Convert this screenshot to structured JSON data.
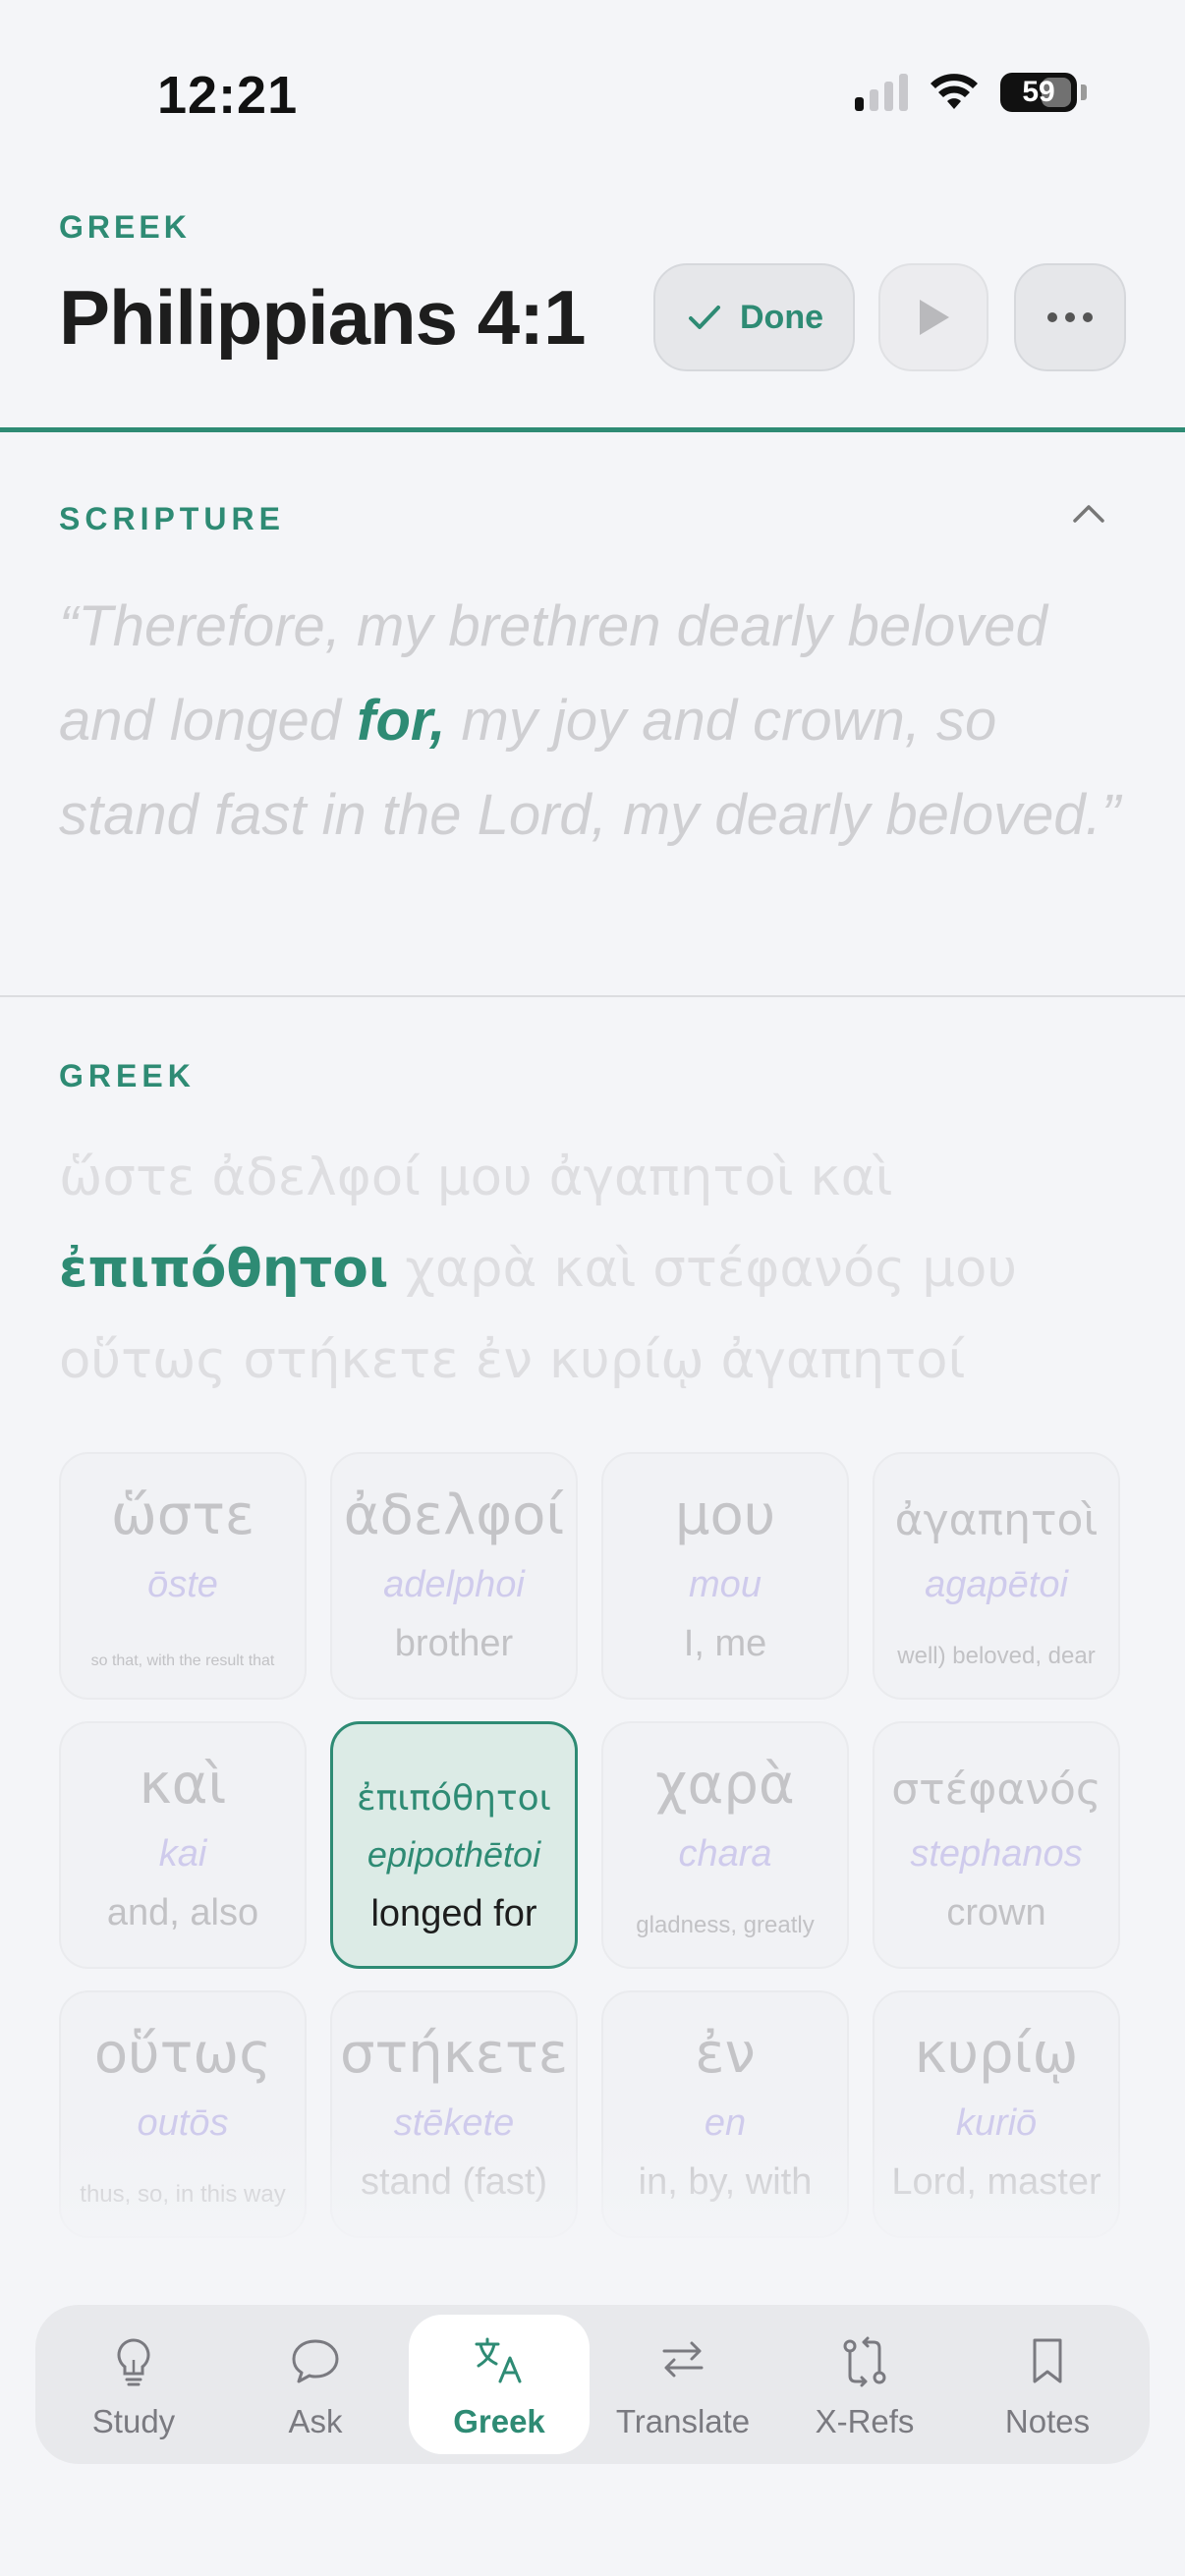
{
  "status": {
    "time": "12:21",
    "battery": "59"
  },
  "header": {
    "eyebrow": "GREEK",
    "title": "Philippians 4:1",
    "done_label": "Done",
    "icons": {
      "done": "check-icon",
      "play": "play-icon",
      "more": "more-icon"
    }
  },
  "scripture": {
    "label": "SCRIPTURE",
    "text_before": "“Therefore, my brethren dearly beloved and longed ",
    "highlight": "for,",
    "text_after": " my joy and crown, so stand fast in the Lord, my dearly beloved.”"
  },
  "greek": {
    "label": "GREEK",
    "text_before": "ὥστε ἀδελφοί μου ἀγαπητοὶ καὶ ",
    "highlight": "ἐπιπόθητοι",
    "text_after": " χαρὰ καὶ στέφανός μου οὕτως στήκετε ἐν κυρίῳ ἀγαπητοί"
  },
  "words": [
    {
      "greek": "ὥστε",
      "translit": "ōste",
      "english": "so that, with the result that",
      "size": "tiny"
    },
    {
      "greek": "ἀδελφοί",
      "translit": "adelphoi",
      "english": "brother",
      "size": "normal"
    },
    {
      "greek": "μου",
      "translit": "mou",
      "english": "I, me",
      "size": "normal"
    },
    {
      "greek": "ἀγαπητοὶ",
      "translit": "agapētoi",
      "english": "well) beloved, dear",
      "size": "small"
    },
    {
      "greek": "καὶ",
      "translit": "kai",
      "english": "and, also",
      "size": "normal"
    },
    {
      "greek": "ἐπιπόθητοι",
      "translit": "epipothētoi",
      "english": "longed for",
      "size": "normal",
      "selected": true
    },
    {
      "greek": "χαρὰ",
      "translit": "chara",
      "english": "gladness, greatly",
      "size": "small"
    },
    {
      "greek": "στέφανός",
      "translit": "stephanos",
      "english": "crown",
      "size": "normal"
    },
    {
      "greek": "οὕτως",
      "translit": "outōs",
      "english": "thus, so, in this way",
      "size": "small"
    },
    {
      "greek": "στήκετε",
      "translit": "stēkete",
      "english": "stand (fast)",
      "size": "normal"
    },
    {
      "greek": "ἐν",
      "translit": "en",
      "english": "in, by, with",
      "size": "normal"
    },
    {
      "greek": "κυρίῳ",
      "translit": "kuriō",
      "english": "Lord, master",
      "size": "normal"
    }
  ],
  "tabs": [
    {
      "label": "Study",
      "icon": "lightbulb-icon"
    },
    {
      "label": "Ask",
      "icon": "chat-bubble-icon"
    },
    {
      "label": "Greek",
      "icon": "translate-language-icon",
      "active": true
    },
    {
      "label": "Translate",
      "icon": "swap-arrows-icon"
    },
    {
      "label": "X-Refs",
      "icon": "cross-reference-icon"
    },
    {
      "label": "Notes",
      "icon": "bookmark-icon"
    }
  ],
  "colors": {
    "accent": "#2e8b74",
    "background": "#f4f5f8",
    "faded_text": "#cfcfd2",
    "translit": "#cfcbec"
  }
}
